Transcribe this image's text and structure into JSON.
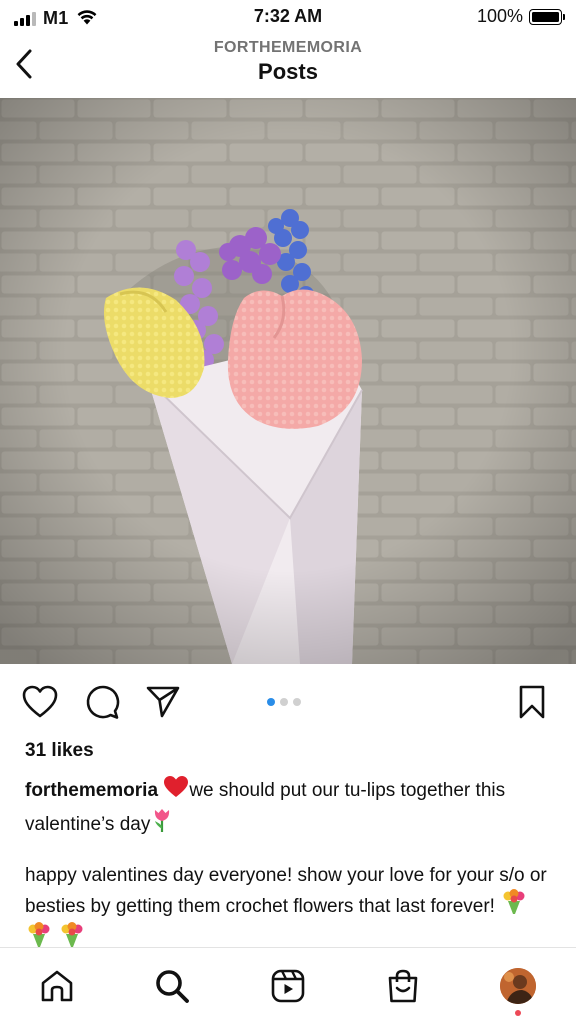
{
  "status_bar": {
    "carrier": "M1",
    "time": "7:32 AM",
    "battery": "100%",
    "icons": [
      "signal-icon",
      "wifi-icon",
      "battery-icon"
    ]
  },
  "header": {
    "username": "FORTHEMEMORIA",
    "title": "Posts",
    "back_icon": "chevron-left-icon"
  },
  "post": {
    "image_icon": "photo",
    "action_icons": [
      "heart-icon",
      "comment-icon",
      "share-icon",
      "bookmark-icon"
    ],
    "carousel": {
      "count": 3,
      "active": 1
    },
    "likes": "31 likes",
    "caption": {
      "username": "forthememoria",
      "line1_text": "we should put our tu-lips together this valentine’s day",
      "line2_text": "happy valentines day everyone! show your love for your s/o or besties by getting them crochet flowers that last forever!",
      "emojis": [
        "heart-emoji",
        "tulip-emoji",
        "bouquet-emoji",
        "bouquet-emoji",
        "bouquet-emoji"
      ]
    }
  },
  "bottom_nav": {
    "items": [
      "home-icon",
      "search-icon",
      "reels-icon",
      "shop-icon",
      "profile-avatar"
    ],
    "active": "search-icon"
  },
  "colors": {
    "accent_blue": "#2a8de8",
    "notification_red": "#ed4956",
    "secondary_text": "#737373"
  }
}
